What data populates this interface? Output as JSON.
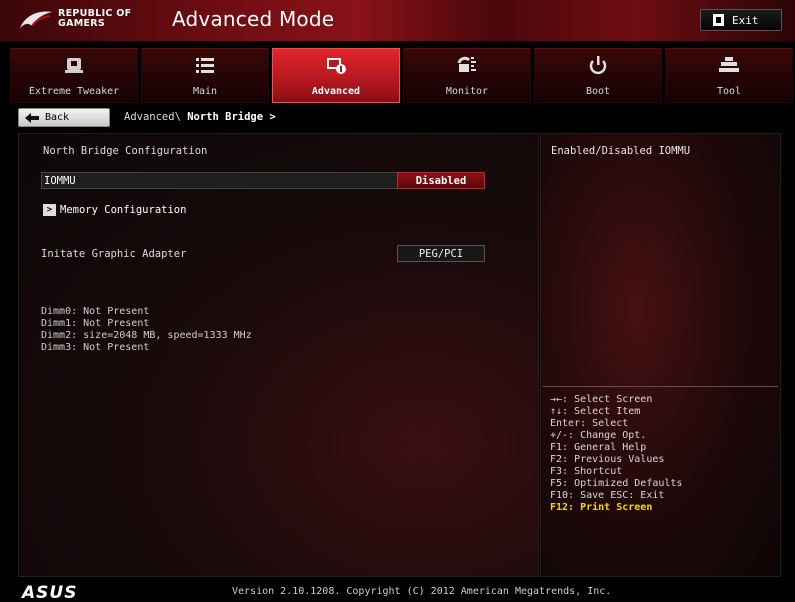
{
  "header": {
    "logo_text": "REPUBLIC OF\nGAMERS",
    "mode_title": "Advanced Mode",
    "exit_label": "Exit"
  },
  "tabs": [
    {
      "label": "Extreme Tweaker",
      "icon": "chip-icon",
      "active": false
    },
    {
      "label": "Main",
      "icon": "list-icon",
      "active": false
    },
    {
      "label": "Advanced",
      "icon": "advanced-settings-icon",
      "active": true
    },
    {
      "label": "Monitor",
      "icon": "monitor-icon",
      "active": false
    },
    {
      "label": "Boot",
      "icon": "power-icon",
      "active": false
    },
    {
      "label": "Tool",
      "icon": "tool-icon",
      "active": false
    }
  ],
  "nav": {
    "back_label": "Back",
    "breadcrumb_path": "Advanced\\ ",
    "breadcrumb_current": "North Bridge >"
  },
  "main": {
    "section_title": "North Bridge Configuration",
    "iommu_label": "IOMMU",
    "iommu_value": "Disabled",
    "memory_config_label": "Memory Configuration",
    "graphic_adapter_label": "Initate Graphic Adapter",
    "graphic_adapter_value": "PEG/PCI",
    "dimm_lines": [
      "Dimm0: Not Present",
      "Dimm1: Not Present",
      "Dimm2: size=2048 MB, speed=1333 MHz",
      "Dimm3: Not Present"
    ]
  },
  "help": {
    "description": "Enabled/Disabled IOMMU",
    "keys": [
      "→←: Select Screen",
      "↑↓: Select Item",
      "Enter: Select",
      "+/-: Change Opt.",
      "F1: General Help",
      "F2: Previous Values",
      "F3: Shortcut",
      "F5: Optimized Defaults",
      "F10: Save  ESC: Exit"
    ],
    "highlight_key": "F12: Print Screen"
  },
  "footer": {
    "brand": "ASUS",
    "version": "Version 2.10.1208. Copyright (C) 2012 American Megatrends, Inc."
  },
  "colors": {
    "accent_red": "#c41a22",
    "highlight_yellow": "#f5d800"
  }
}
